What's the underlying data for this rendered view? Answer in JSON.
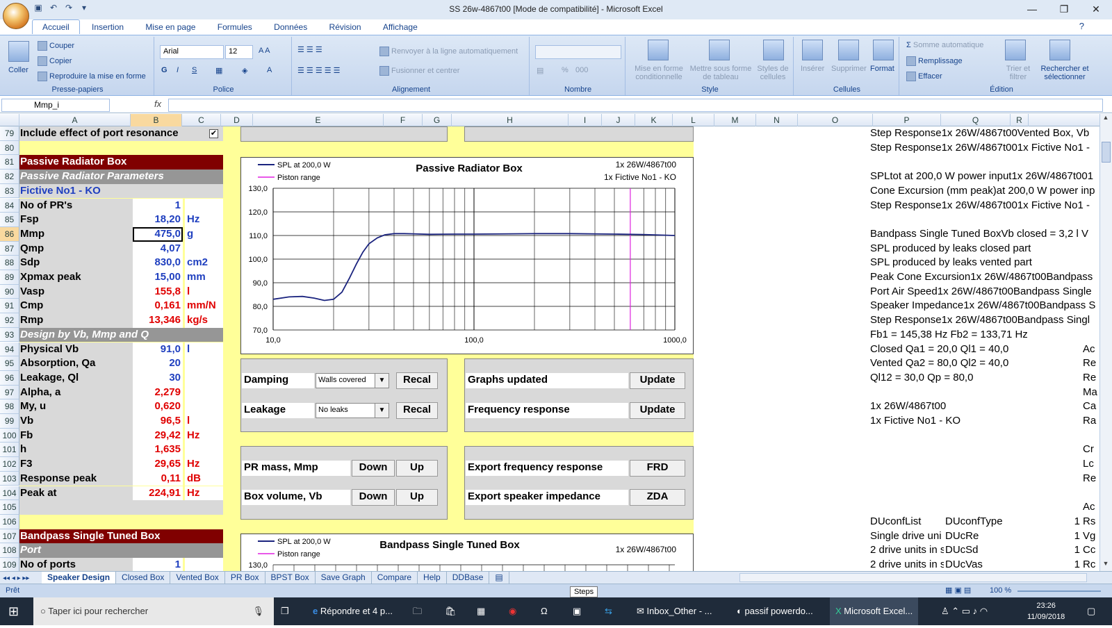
{
  "window": {
    "title": "SS 26w-4867t00  [Mode de compatibilité] - Microsoft Excel"
  },
  "ribbon_tabs": [
    "Accueil",
    "Insertion",
    "Mise en page",
    "Formules",
    "Données",
    "Révision",
    "Affichage"
  ],
  "clipboard": {
    "paste": "Coller",
    "cut": "Couper",
    "copy": "Copier",
    "format_painter": "Reproduire la mise en forme",
    "label": "Presse-papiers"
  },
  "font": {
    "name": "Arial",
    "size": "12",
    "label": "Police"
  },
  "alignment": {
    "wrap": "Renvoyer à la ligne automatiquement",
    "merge": "Fusionner et centrer",
    "label": "Alignement"
  },
  "number": {
    "label": "Nombre",
    "percent": "%",
    "thousands": "000"
  },
  "styles": {
    "cond": "Mise en forme conditionnelle",
    "table": "Mettre sous forme de tableau",
    "cell": "Styles de cellules",
    "label": "Style"
  },
  "cells": {
    "insert": "Insérer",
    "delete": "Supprimer",
    "format": "Format",
    "label": "Cellules"
  },
  "editing": {
    "autosum": "Somme automatique",
    "fill": "Remplissage",
    "clear": "Effacer",
    "sort": "Trier et filtrer",
    "find": "Rechercher et sélectionner",
    "label": "Édition"
  },
  "formula_bar": {
    "name_box": "Mmp_i",
    "fx": "fx"
  },
  "columns": [
    "A",
    "B",
    "C",
    "D",
    "E",
    "F",
    "G",
    "H",
    "I",
    "J",
    "K",
    "L",
    "M",
    "N",
    "O",
    "P",
    "Q",
    "R"
  ],
  "rows": [
    {
      "n": "79",
      "label": "Include effect of port resonance",
      "value": "",
      "unit": "",
      "style": "check"
    },
    {
      "n": "80",
      "label": "",
      "value": "",
      "unit": "",
      "style": "plain"
    },
    {
      "n": "81",
      "label": "Passive Radiator Box",
      "value": "",
      "unit": "",
      "style": "header"
    },
    {
      "n": "82",
      "label": "Passive Radiator Parameters",
      "value": "",
      "unit": "",
      "style": "subheader"
    },
    {
      "n": "83",
      "label": "Fictive No1 - KO",
      "value": "",
      "unit": "",
      "style": "blue"
    },
    {
      "n": "84",
      "label": "No of PR's",
      "value": "1",
      "unit": "",
      "style": "blueval"
    },
    {
      "n": "85",
      "label": "Fsp",
      "value": "18,20",
      "unit": "Hz",
      "style": "blueval"
    },
    {
      "n": "86",
      "label": "Mmp",
      "value": "475,0",
      "unit": "g",
      "style": "blueval"
    },
    {
      "n": "87",
      "label": "Qmp",
      "value": "4,07",
      "unit": "",
      "style": "blueval"
    },
    {
      "n": "88",
      "label": "Sdp",
      "value": "830,0",
      "unit": "cm2",
      "style": "blueval"
    },
    {
      "n": "89",
      "label": "Xpmax peak",
      "value": "15,00",
      "unit": "mm",
      "style": "blueval"
    },
    {
      "n": "90",
      "label": "Vasp",
      "value": "155,8",
      "unit": "l",
      "style": "redval"
    },
    {
      "n": "91",
      "label": "Cmp",
      "value": "0,161",
      "unit": "mm/N",
      "style": "redval"
    },
    {
      "n": "92",
      "label": "Rmp",
      "value": "13,346",
      "unit": "kg/s",
      "style": "redval"
    },
    {
      "n": "93",
      "label": "Design by Vb, Mmp and Q",
      "value": "",
      "unit": "",
      "style": "subheader"
    },
    {
      "n": "94",
      "label": "Physical Vb",
      "value": "91,0",
      "unit": "l",
      "style": "blueval"
    },
    {
      "n": "95",
      "label": "Absorption, Qa",
      "value": "20",
      "unit": "",
      "style": "blueval"
    },
    {
      "n": "96",
      "label": "Leakage, Ql",
      "value": "30",
      "unit": "",
      "style": "blueval"
    },
    {
      "n": "97",
      "label": "Alpha, a",
      "value": "2,279",
      "unit": "",
      "style": "redval"
    },
    {
      "n": "98",
      "label": "My, u",
      "value": "0,620",
      "unit": "",
      "style": "redval"
    },
    {
      "n": "99",
      "label": "Vb",
      "value": "96,5",
      "unit": "l",
      "style": "redval"
    },
    {
      "n": "100",
      "label": "Fb",
      "value": "29,42",
      "unit": "Hz",
      "style": "redval"
    },
    {
      "n": "101",
      "label": "h",
      "value": "1,635",
      "unit": "",
      "style": "redval"
    },
    {
      "n": "102",
      "label": "F3",
      "value": "29,65",
      "unit": "Hz",
      "style": "redval"
    },
    {
      "n": "103",
      "label": "Response peak",
      "value": "0,11",
      "unit": "dB",
      "style": "redval"
    },
    {
      "n": "104",
      "label": "Peak at",
      "value": "224,91",
      "unit": "Hz",
      "style": "redval"
    },
    {
      "n": "105",
      "label": "",
      "value": "",
      "unit": "",
      "style": "gray"
    },
    {
      "n": "106",
      "label": "",
      "value": "",
      "unit": "",
      "style": "plain"
    },
    {
      "n": "107",
      "label": "Bandpass Single Tuned Box",
      "value": "",
      "unit": "",
      "style": "header"
    },
    {
      "n": "108",
      "label": "Port",
      "value": "",
      "unit": "",
      "style": "subheader"
    },
    {
      "n": "109",
      "label": "No of ports",
      "value": "1",
      "unit": "",
      "style": "blueval"
    }
  ],
  "controls": {
    "damping_label": "Damping",
    "damping_value": "Walls covered",
    "recal1": "Recal",
    "leakage_label": "Leakage",
    "leakage_value": "No leaks",
    "recal2": "Recal",
    "graphs_label": "Graphs updated",
    "update1": "Update",
    "freq_label": "Frequency response",
    "update2": "Update",
    "pr_mass_label": "PR mass, Mmp",
    "down1": "Down",
    "up1": "Up",
    "box_vol_label": "Box volume, Vb",
    "down2": "Down",
    "up2": "Up",
    "export_freq_label": "Export frequency response",
    "frd": "FRD",
    "export_imp_label": "Export speaker impedance",
    "zda": "ZDA"
  },
  "chart_data": [
    {
      "type": "line",
      "title": "Passive Radiator Box",
      "subtitle_lines": [
        "1x 26W/4867t00",
        "1x Fictive No1 - KO"
      ],
      "legend": [
        "SPL at 200,0 W",
        "Piston range"
      ],
      "x_scale": "log",
      "xlim": [
        10,
        1000
      ],
      "x_ticks": [
        "10,0",
        "100,0",
        "1000,0"
      ],
      "ylim": [
        70,
        130
      ],
      "y_ticks": [
        "130,0",
        "120,0",
        "110,0",
        "100,0",
        "90,0",
        "80,0",
        "70,0"
      ],
      "series": [
        {
          "name": "SPL at 200,0 W",
          "color": "#1a237e",
          "x": [
            10,
            12,
            14,
            16,
            18,
            20,
            22,
            24,
            26,
            28,
            30,
            33,
            36,
            40,
            45,
            50,
            60,
            80,
            100,
            150,
            200,
            300,
            500,
            700,
            1000
          ],
          "y": [
            83.0,
            84.0,
            84.2,
            83.5,
            82.5,
            83.0,
            86.0,
            92.0,
            98.0,
            103.0,
            106.5,
            109.0,
            110.3,
            110.8,
            110.8,
            110.7,
            110.5,
            110.6,
            110.6,
            110.7,
            110.8,
            110.8,
            110.6,
            110.4,
            110.0
          ]
        }
      ],
      "piston_range_hz": 600,
      "piston_color": "#e020e0"
    },
    {
      "type": "line",
      "title": "Bandpass Single Tuned Box",
      "subtitle_lines": [
        "1x 26W/4867t00"
      ],
      "legend": [
        "SPL at 200,0 W",
        "Piston range"
      ],
      "y_ticks": [
        "130,0"
      ]
    }
  ],
  "right_text": [
    {
      "row": "79",
      "text": "Step Response1x 26W/4867t00Vented Box, Vb"
    },
    {
      "row": "80",
      "text": "Step Response1x 26W/4867t001x Fictive No1 -"
    },
    {
      "row": "82",
      "text": "SPLtot at 200,0 W power input1x 26W/4867t001"
    },
    {
      "row": "83",
      "text": "Cone Excursion (mm peak)at 200,0 W power inp"
    },
    {
      "row": "84",
      "text": "Step Response1x 26W/4867t001x Fictive No1 -"
    },
    {
      "row": "86",
      "text": "Bandpass Single Tuned BoxVb closed = 3,2 l   V"
    },
    {
      "row": "87",
      "text": "SPL produced by leaks closed part"
    },
    {
      "row": "88",
      "text": "SPL produced by leaks vented part"
    },
    {
      "row": "89",
      "text": "Peak Cone Excursion1x 26W/4867t00Bandpass"
    },
    {
      "row": "90",
      "text": "Port Air Speed1x 26W/4867t00Bandpass Single"
    },
    {
      "row": "91",
      "text": "Speaker Impedance1x 26W/4867t00Bandpass S"
    },
    {
      "row": "92",
      "text": "Step Response1x 26W/4867t00Bandpass Singl"
    },
    {
      "row": "93",
      "text": "Fb1 = 145,38 Hz  Fb2 = 133,71 Hz"
    },
    {
      "row": "94",
      "text": "Closed Qa1 = 20,0  Ql1 = 40,0"
    },
    {
      "row": "95",
      "text": "Vented Qa2 = 80,0  Ql2 = 40,0"
    },
    {
      "row": "96",
      "text": "Ql12 = 30,0  Qp = 80,0"
    },
    {
      "row": "98",
      "text": "1x 26W/4867t00"
    },
    {
      "row": "99",
      "text": "1x Fictive No1 - KO"
    },
    {
      "row": "106",
      "text": "DUconfList"
    },
    {
      "row": "107",
      "text": "Single drive uni"
    },
    {
      "row": "108",
      "text": "2 drive units in s"
    },
    {
      "row": "109",
      "text": "2 drive units in s"
    }
  ],
  "col_q_text": [
    {
      "row": "106",
      "text": "DUconfType"
    },
    {
      "row": "107",
      "text": "DUcRe"
    },
    {
      "row": "108",
      "text": "DUcSd"
    },
    {
      "row": "109",
      "text": "DUcVas"
    }
  ],
  "col_r_ones": [
    {
      "row": "106",
      "text": "1"
    },
    {
      "row": "107",
      "text": "1"
    },
    {
      "row": "108",
      "text": "1"
    },
    {
      "row": "109",
      "text": "1"
    }
  ],
  "col_s_text": [
    {
      "row": "94",
      "text": "Ac"
    },
    {
      "row": "95",
      "text": "Re"
    },
    {
      "row": "96",
      "text": "Re"
    },
    {
      "row": "97",
      "text": "Ma"
    },
    {
      "row": "98",
      "text": "Ca"
    },
    {
      "row": "99",
      "text": "Ra"
    },
    {
      "row": "101",
      "text": "Cr"
    },
    {
      "row": "102",
      "text": "Lc"
    },
    {
      "row": "103",
      "text": "Re"
    },
    {
      "row": "105",
      "text": "Ac"
    },
    {
      "row": "106",
      "text": "Rs"
    },
    {
      "row": "107",
      "text": "Vg"
    },
    {
      "row": "108",
      "text": "Cc"
    },
    {
      "row": "109",
      "text": "Rc"
    }
  ],
  "sheet_tabs": [
    "Speaker Design",
    "Closed Box",
    "Vented Box",
    "PR Box",
    "BPST Box",
    "Save Graph",
    "Compare",
    "Help",
    "DDBase"
  ],
  "status": {
    "ready": "Prêt",
    "tooltip": "Steps",
    "zoom": "100 %"
  },
  "taskbar": {
    "search": "Taper ici pour rechercher",
    "items": [
      "Répondre et 4 p...",
      "Inbox_Other - ...",
      "passif powerdo...",
      "Microsoft Excel..."
    ],
    "time": "23:26",
    "date": "11/09/2018"
  }
}
